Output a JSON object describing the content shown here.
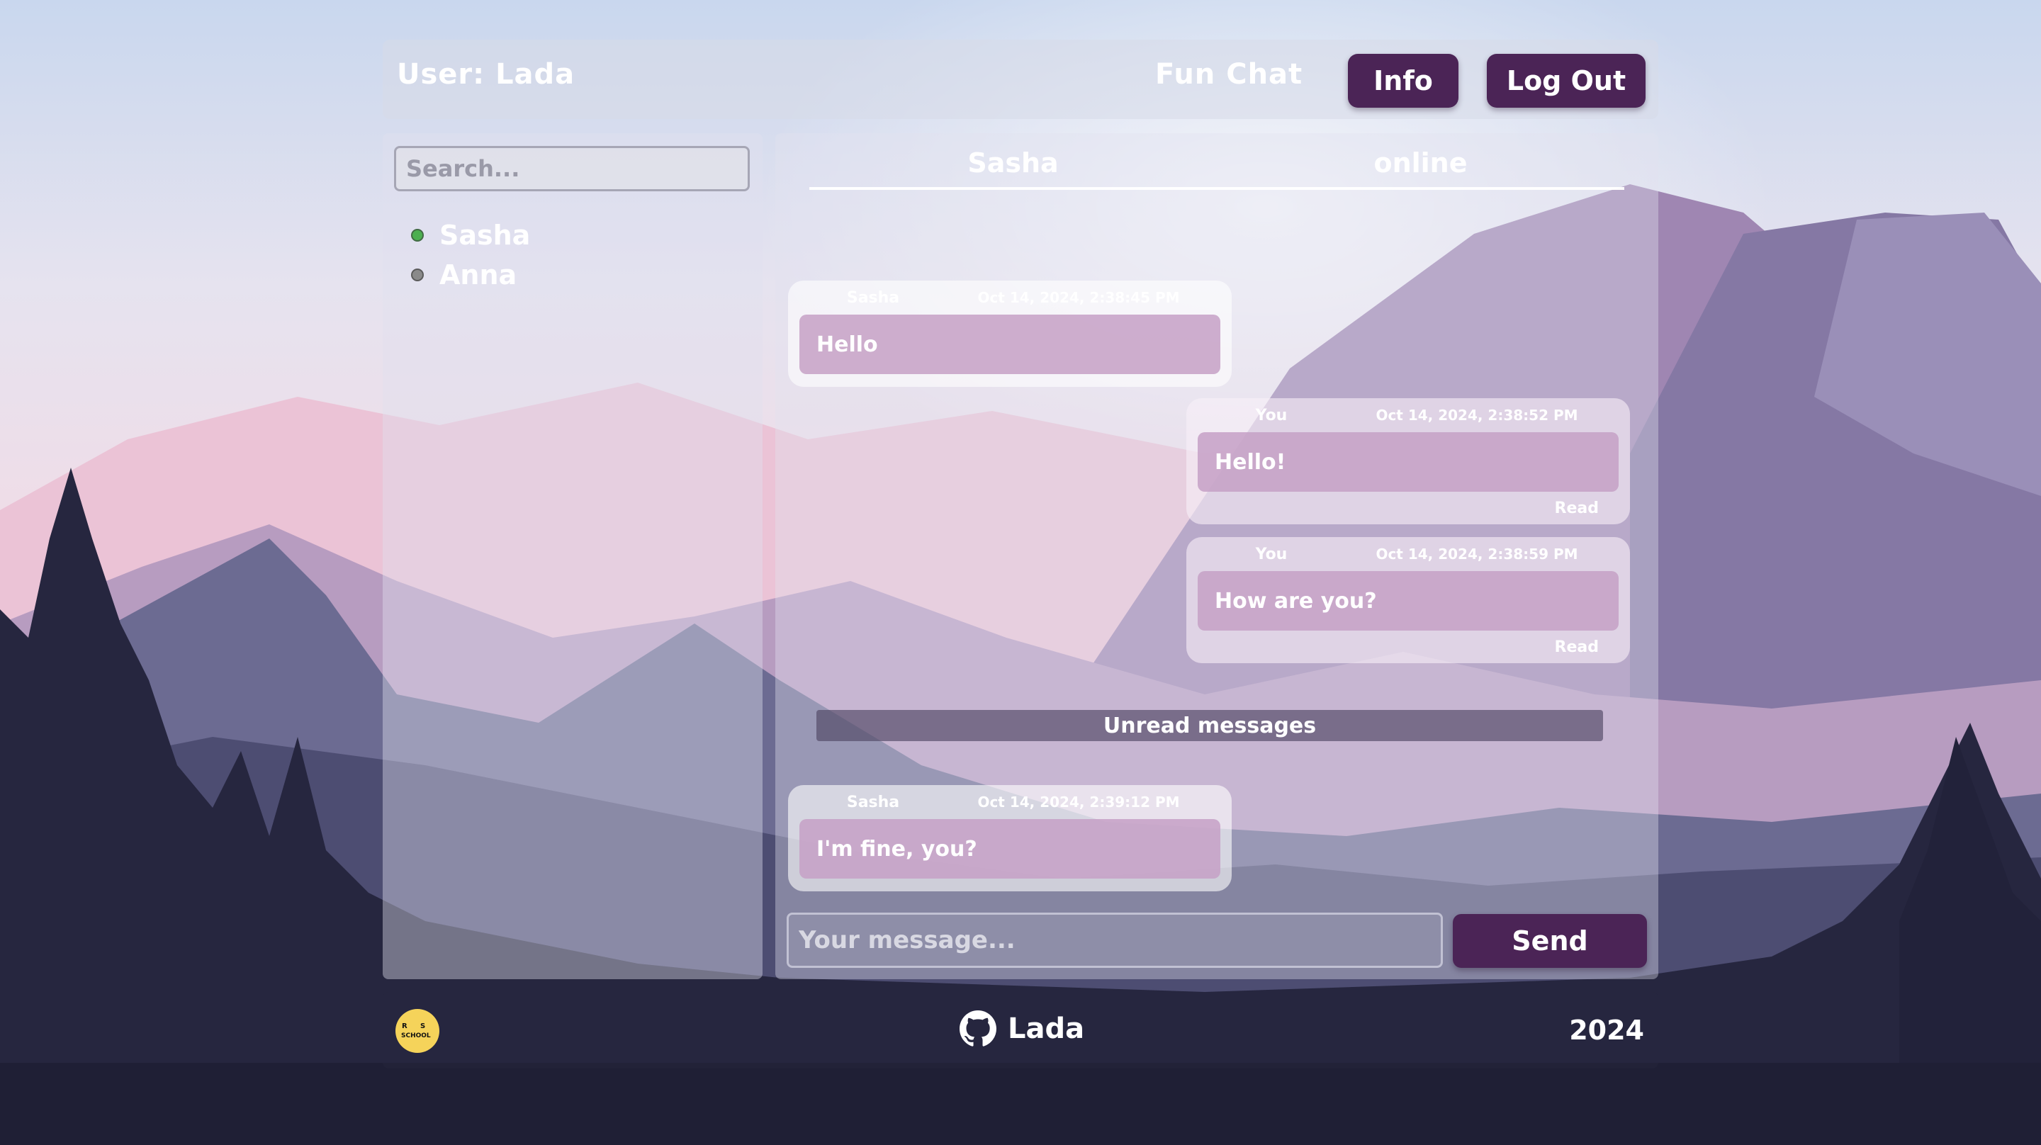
{
  "header": {
    "user_label": "User: Lada",
    "app_title": "Fun Chat",
    "info_label": "Info",
    "logout_label": "Log Out"
  },
  "sidebar": {
    "search_placeholder": "Search...",
    "contacts": [
      {
        "name": "Sasha",
        "status": "online",
        "dot_color": "#4caf50"
      },
      {
        "name": "Anna",
        "status": "offline",
        "dot_color": "#8a8a8a"
      }
    ]
  },
  "chat": {
    "peer_name": "Sasha",
    "peer_status": "online",
    "messages": [
      {
        "author": "Sasha",
        "date": "Oct 14, 2024, 2:38:45 PM",
        "text": "Hello",
        "direction": "in"
      },
      {
        "author": "You",
        "date": "Oct 14, 2024, 2:38:52 PM",
        "text": "Hello!",
        "direction": "out",
        "status": "Read"
      },
      {
        "author": "You",
        "date": "Oct 14, 2024, 2:38:59 PM",
        "text": "How are you?",
        "direction": "out",
        "status": "Read"
      },
      {
        "author": "Sasha",
        "date": "Oct 14, 2024, 2:39:12 PM",
        "text": "I'm fine, you?",
        "direction": "in"
      }
    ],
    "unread_divider": "Unread messages",
    "input_placeholder": "Your message...",
    "send_label": "Send"
  },
  "footer": {
    "logo_icon": "rs-school-logo",
    "github_icon": "github-icon",
    "github_name": "Lada",
    "year": "2024"
  },
  "colors": {
    "accent": "#4b2456",
    "bubble": "#c6a0c6",
    "online": "#4caf50",
    "offline": "#8a8a8a"
  }
}
